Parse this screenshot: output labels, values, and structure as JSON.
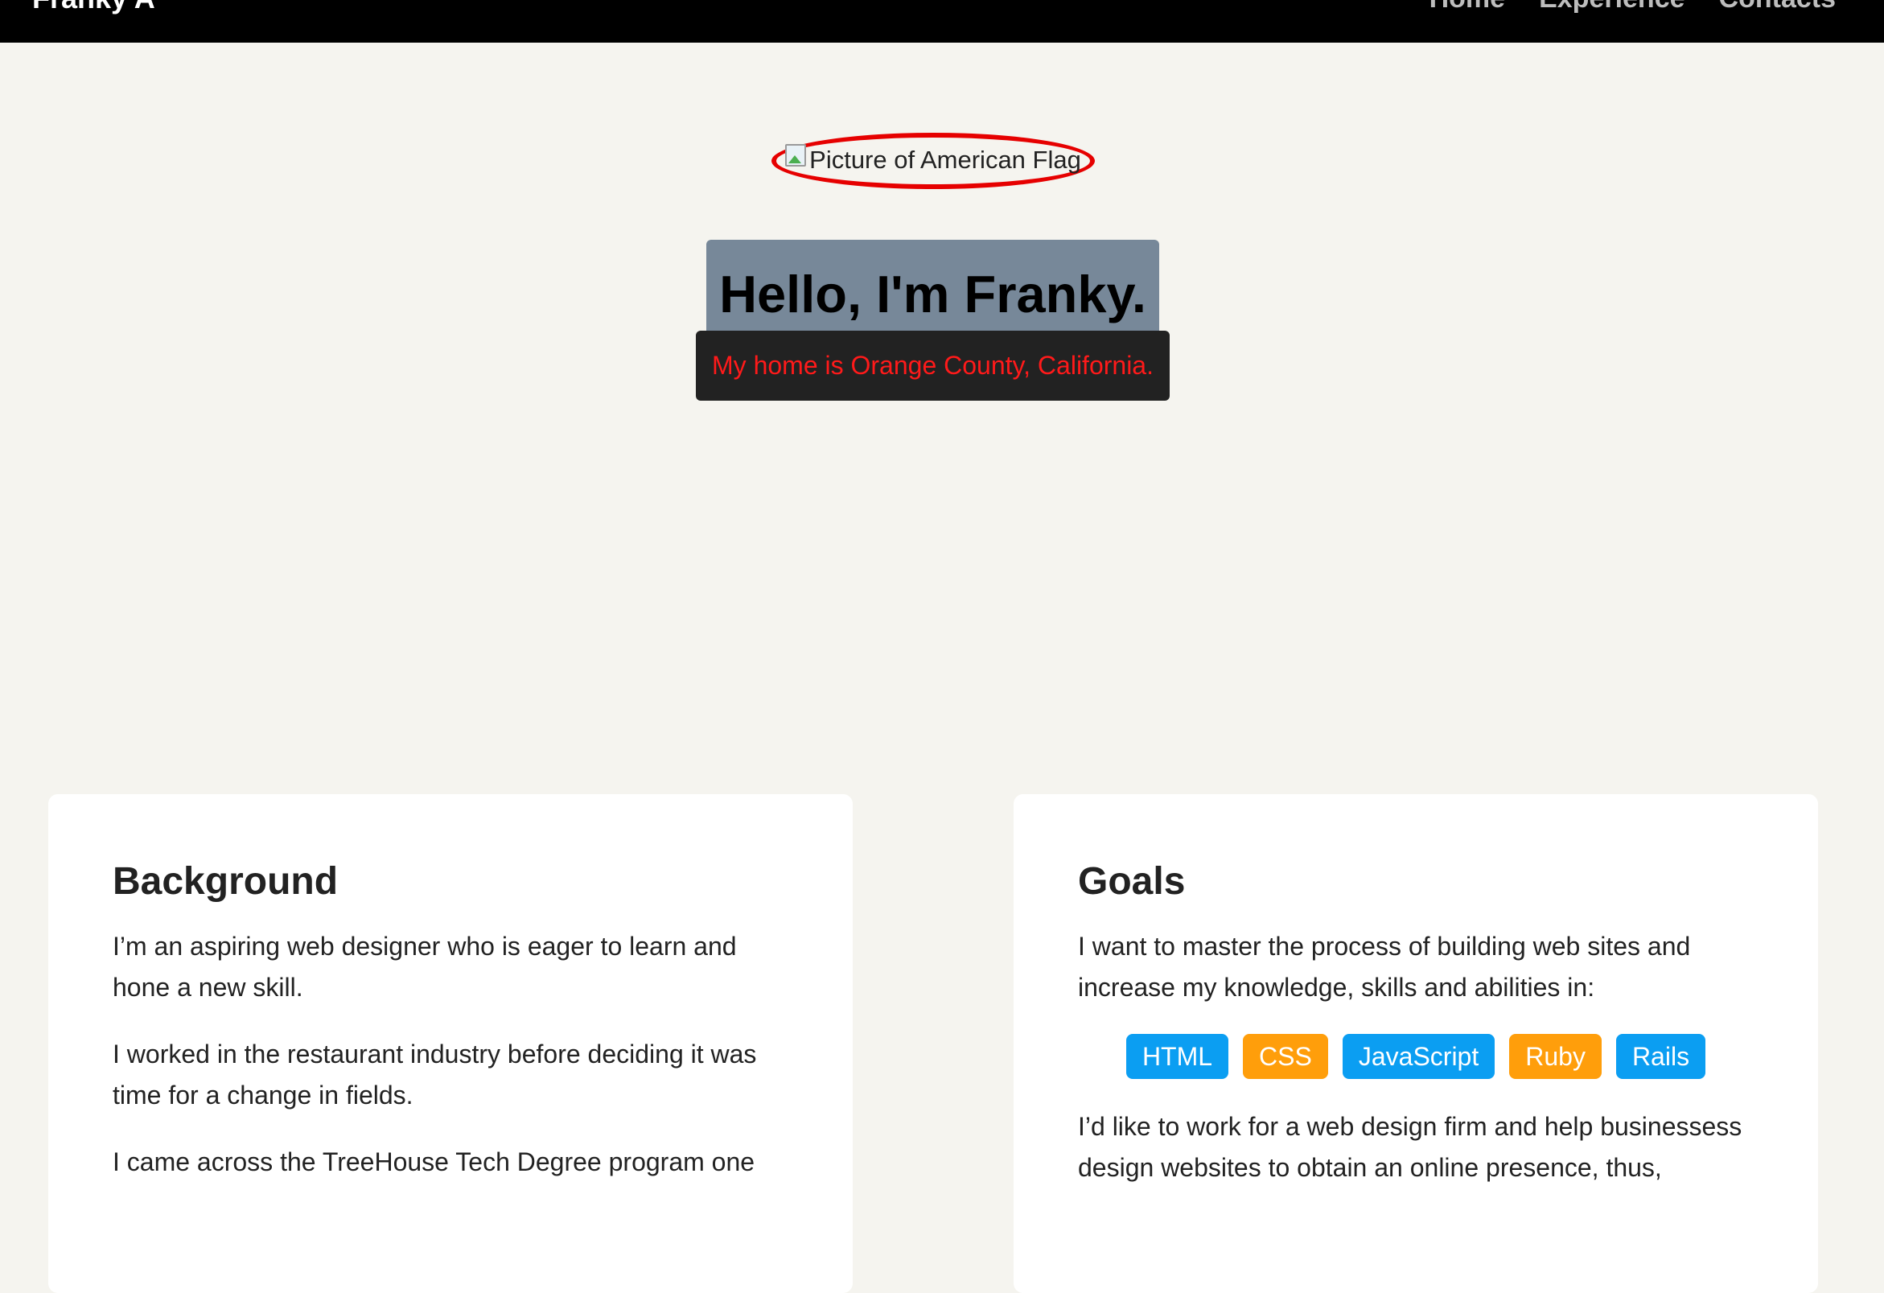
{
  "nav": {
    "brand": "Franky A",
    "links": [
      "Home",
      "Experience",
      "Contacts"
    ]
  },
  "hero": {
    "image_alt": "Picture of American Flag",
    "greeting": "Hello, I'm Franky.",
    "home": "My home is Orange County, California."
  },
  "background": {
    "title": "Background",
    "paragraphs": [
      "I’m an aspiring web designer who is eager to learn and hone a new skill.",
      "I worked in the restaurant industry before deciding it was time for a change in fields.",
      "I came across the TreeHouse Tech Degree program one"
    ]
  },
  "goals": {
    "title": "Goals",
    "intro": "I want to master the process of building web sites and increase my knowledge, skills and abilities in:",
    "tags": [
      {
        "label": "HTML",
        "color": "#0b9ef2"
      },
      {
        "label": "CSS",
        "color": "#ff9e0b"
      },
      {
        "label": "JavaScript",
        "color": "#0b9ef2"
      },
      {
        "label": "Ruby",
        "color": "#ff9e0b"
      },
      {
        "label": "Rails",
        "color": "#0b9ef2"
      }
    ],
    "outro": "I’d like to work for a web design firm and help businessess design websites to obtain an online presence, thus,"
  },
  "colors": {
    "nav_bg": "#000000",
    "page_bg": "#f5f4ef",
    "greeting_bg": "#778899",
    "home_bg": "#222222",
    "home_text": "#ff1a1a",
    "flag_outline": "#e60000"
  },
  "icons": {
    "broken_image": "broken-image-icon"
  }
}
